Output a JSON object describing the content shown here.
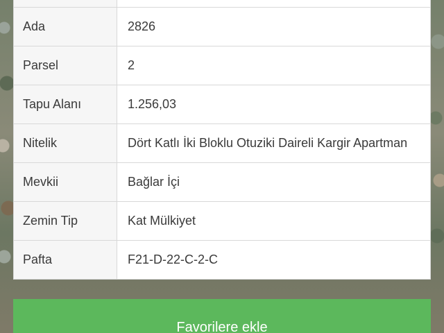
{
  "details": {
    "rows": [
      {
        "label": "Ada",
        "value": "2826"
      },
      {
        "label": "Parsel",
        "value": "2"
      },
      {
        "label": "Tapu Alanı",
        "value": "1.256,03"
      },
      {
        "label": "Nitelik",
        "value": "Dört Katlı İki Bloklu Otuziki Daireli Kargir Apartman"
      },
      {
        "label": "Mevkii",
        "value": "Bağlar İçi"
      },
      {
        "label": "Zemin Tip",
        "value": "Kat Mülkiyet"
      },
      {
        "label": "Pafta",
        "value": "F21-D-22-C-2-C"
      }
    ]
  },
  "actions": {
    "favorite_label": "Favorilere ekle"
  },
  "colors": {
    "button": "#5cb85c",
    "label_bg": "#f6f6f6",
    "border": "#d8d8d8"
  }
}
